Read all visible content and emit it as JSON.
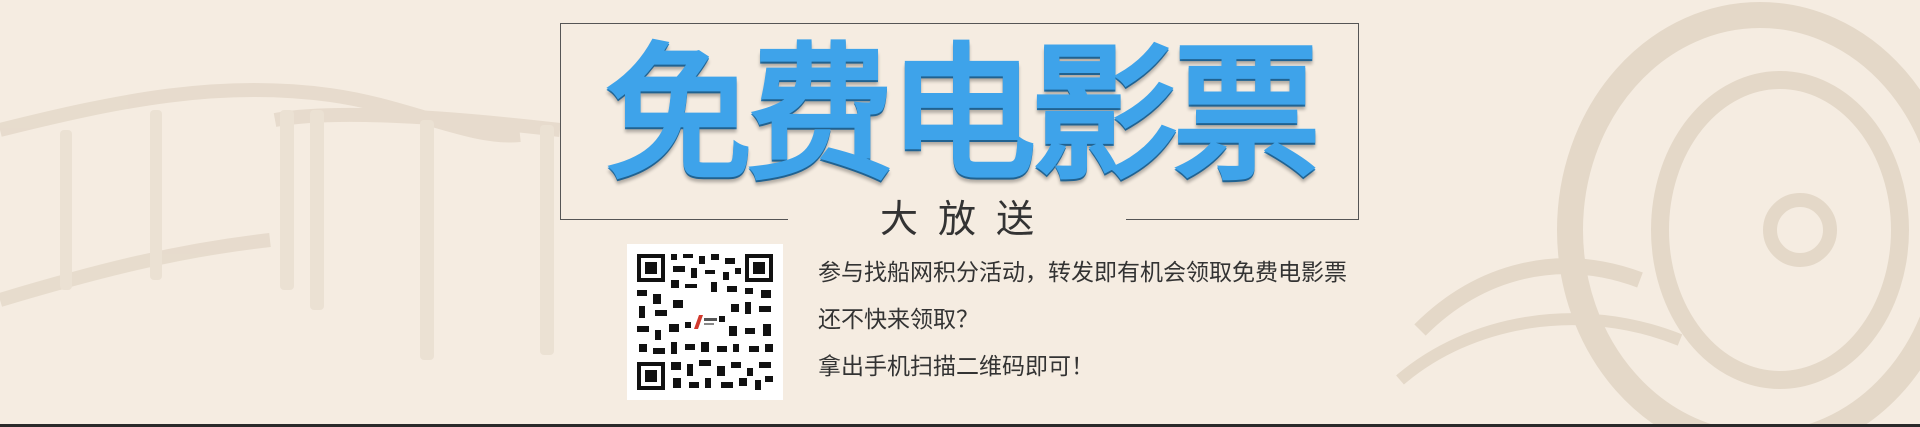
{
  "banner": {
    "headline": "免费电影票",
    "subhead": "大放送",
    "lines": [
      "参与找船网积分活动，转发即有机会领取免费电影票",
      "还不快来领取？",
      "拿出手机扫描二维码即可！"
    ]
  },
  "colors": {
    "background": "#f5ece1",
    "headline": "#3ea3ea",
    "text": "#333333",
    "decor": "#e8ddcf"
  },
  "icons": {
    "qr": "qr-code-icon",
    "reel": "film-reel-icon",
    "strip": "film-strip-icon"
  }
}
